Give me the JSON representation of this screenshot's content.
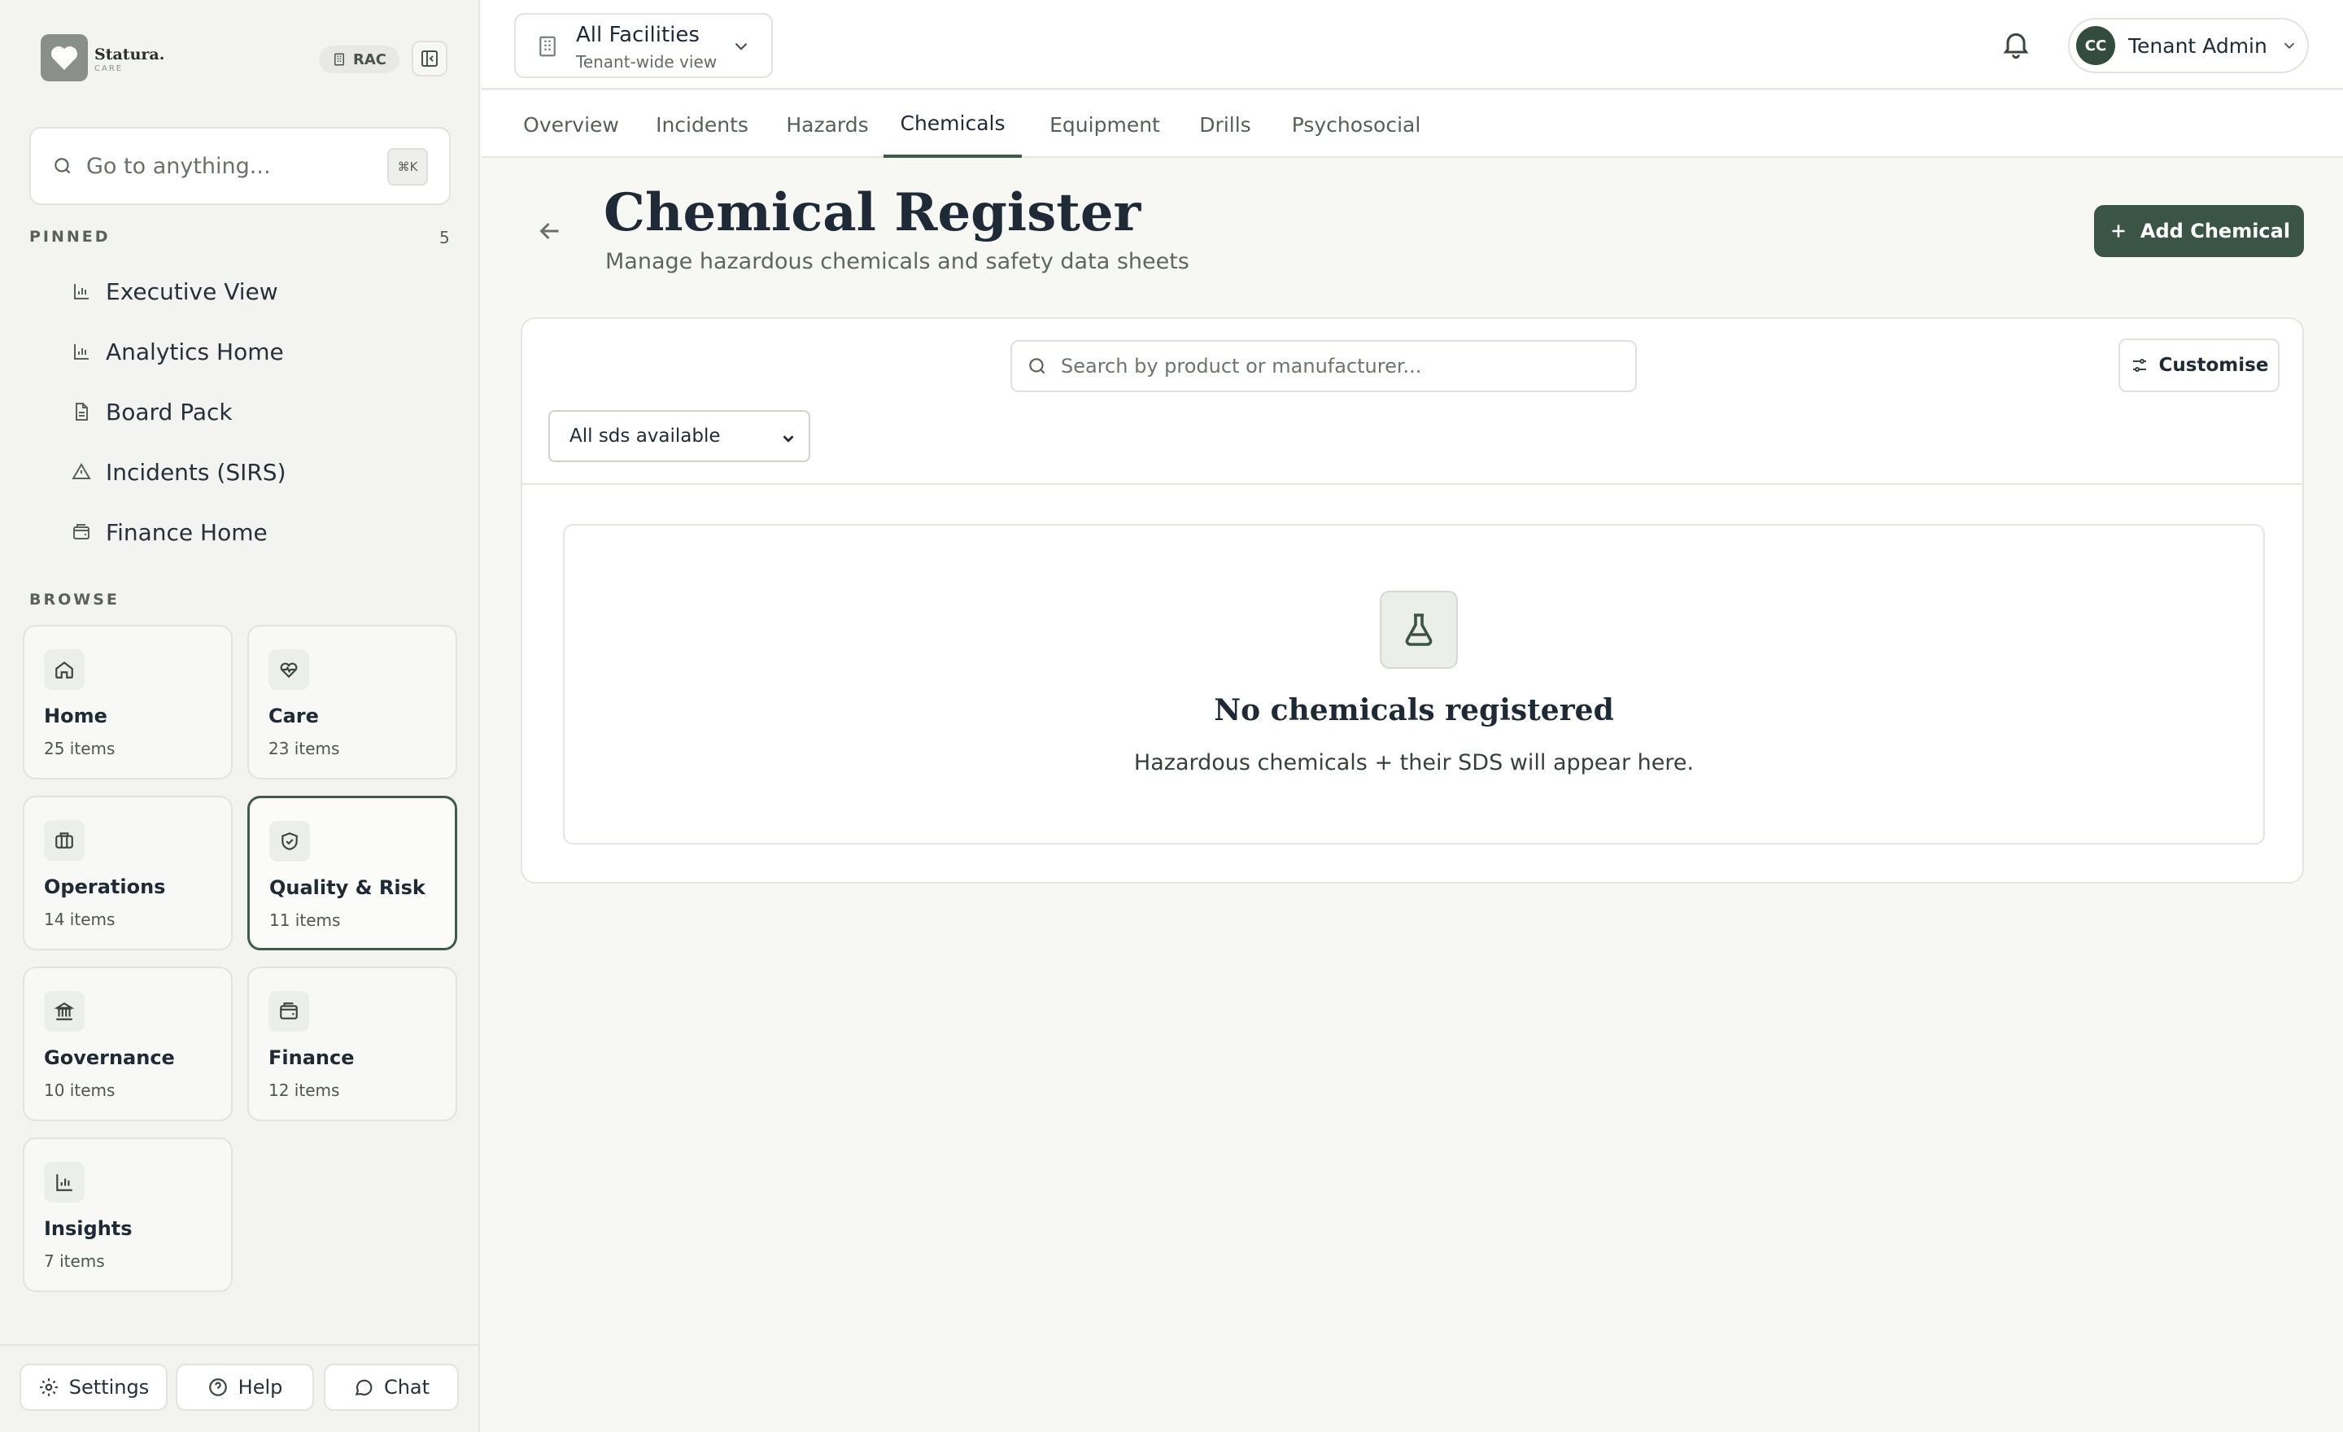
{
  "brand": {
    "name": "Statura.",
    "sub": "CARE",
    "badge": "RAC"
  },
  "sidebar": {
    "search_placeholder": "Go to anything...",
    "search_shortcut": "⌘K",
    "pinned_label": "PINNED",
    "pinned_count": "5",
    "pinned": [
      {
        "label": "Executive View",
        "icon": "bar-chart-icon"
      },
      {
        "label": "Analytics Home",
        "icon": "bar-chart-icon"
      },
      {
        "label": "Board Pack",
        "icon": "document-icon"
      },
      {
        "label": "Incidents (SIRS)",
        "icon": "warning-icon"
      },
      {
        "label": "Finance Home",
        "icon": "wallet-icon"
      }
    ],
    "browse_label": "BROWSE",
    "tiles": [
      {
        "title": "Home",
        "count": "25 items",
        "icon": "home-icon"
      },
      {
        "title": "Care",
        "count": "23 items",
        "icon": "heart-pulse-icon"
      },
      {
        "title": "Operations",
        "count": "14 items",
        "icon": "briefcase-icon"
      },
      {
        "title": "Quality & Risk",
        "count": "11 items",
        "icon": "shield-check-icon"
      },
      {
        "title": "Governance",
        "count": "10 items",
        "icon": "landmark-icon"
      },
      {
        "title": "Finance",
        "count": "12 items",
        "icon": "wallet-icon"
      },
      {
        "title": "Insights",
        "count": "7 items",
        "icon": "bar-chart-icon"
      }
    ],
    "footer": {
      "settings": "Settings",
      "help": "Help",
      "chat": "Chat"
    }
  },
  "topbar": {
    "facility_name": "All Facilities",
    "facility_sub": "Tenant-wide view",
    "user_initials": "CC",
    "user_name": "Tenant Admin"
  },
  "tabs": [
    "Overview",
    "Incidents",
    "Hazards",
    "Chemicals",
    "Equipment",
    "Drills",
    "Psychosocial"
  ],
  "active_tab": "Chemicals",
  "page": {
    "title": "Chemical Register",
    "subtitle": "Manage hazardous chemicals and safety data sheets",
    "add_button": "Add Chemical",
    "search_placeholder": "Search by product or manufacturer...",
    "customise": "Customise",
    "filter_value": "All sds available",
    "empty_title": "No chemicals registered",
    "empty_text": "Hazardous chemicals + their SDS will appear here."
  },
  "colors": {
    "accent": "#3a5546",
    "background": "#f7f7f4",
    "panel": "#ffffff"
  }
}
